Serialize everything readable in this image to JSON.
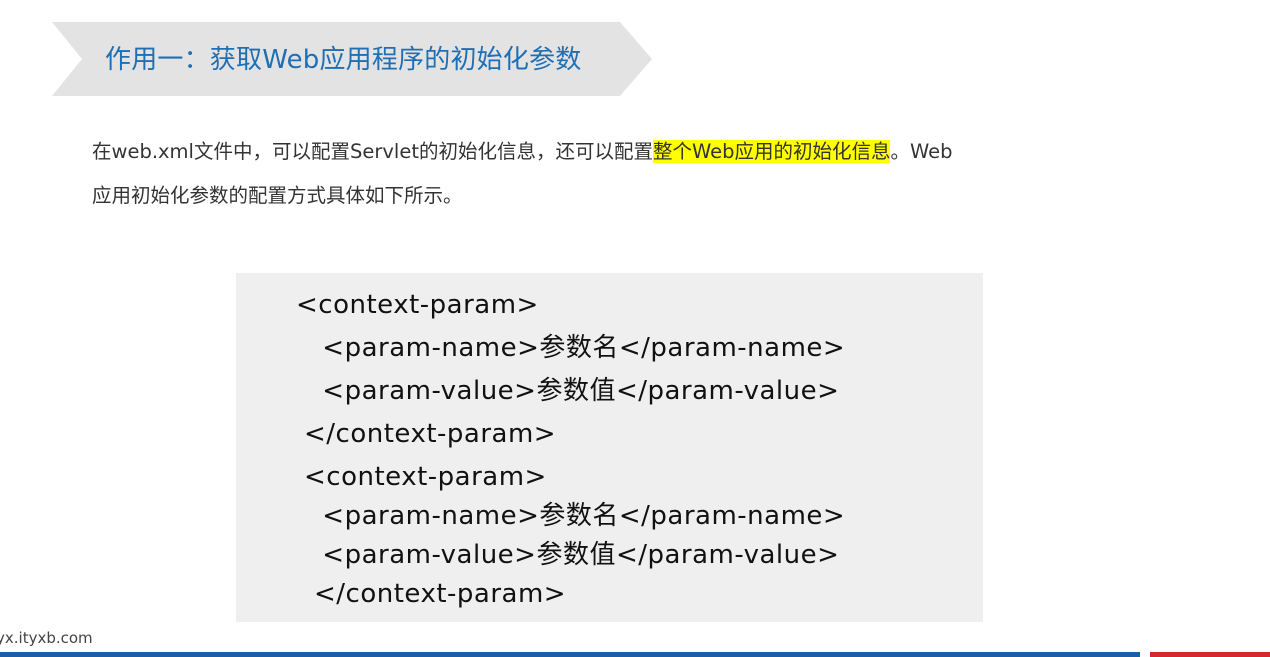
{
  "title": {
    "text": "作用一：获取Web应用程序的初始化参数",
    "color": "#1f6fb5",
    "banner_color": "#e3e3e3"
  },
  "intro": {
    "part1": "在web.xml文件中，可以配置Servlet的初始化信息，还可以配置",
    "highlight": "整个Web应用的初始化信息",
    "part2": "。Web",
    "line2": "应用初始化参数的配置方式具体如下所示。",
    "highlight_color": "#ffff00"
  },
  "code": {
    "lines": [
      "<context-param>",
      "   <param-name>参数名</param-name>",
      "   <param-value>参数值</param-value>",
      "</context-param>",
      "<context-param>",
      "   <param-name>参数名</param-name>",
      "   <param-value>参数值</param-value>",
      "</context-param>"
    ],
    "background": "#efefef"
  },
  "footer": {
    "url": "yx.ityxb.com",
    "bar_blue": "#1a5fa8",
    "bar_red": "#d9262b"
  }
}
